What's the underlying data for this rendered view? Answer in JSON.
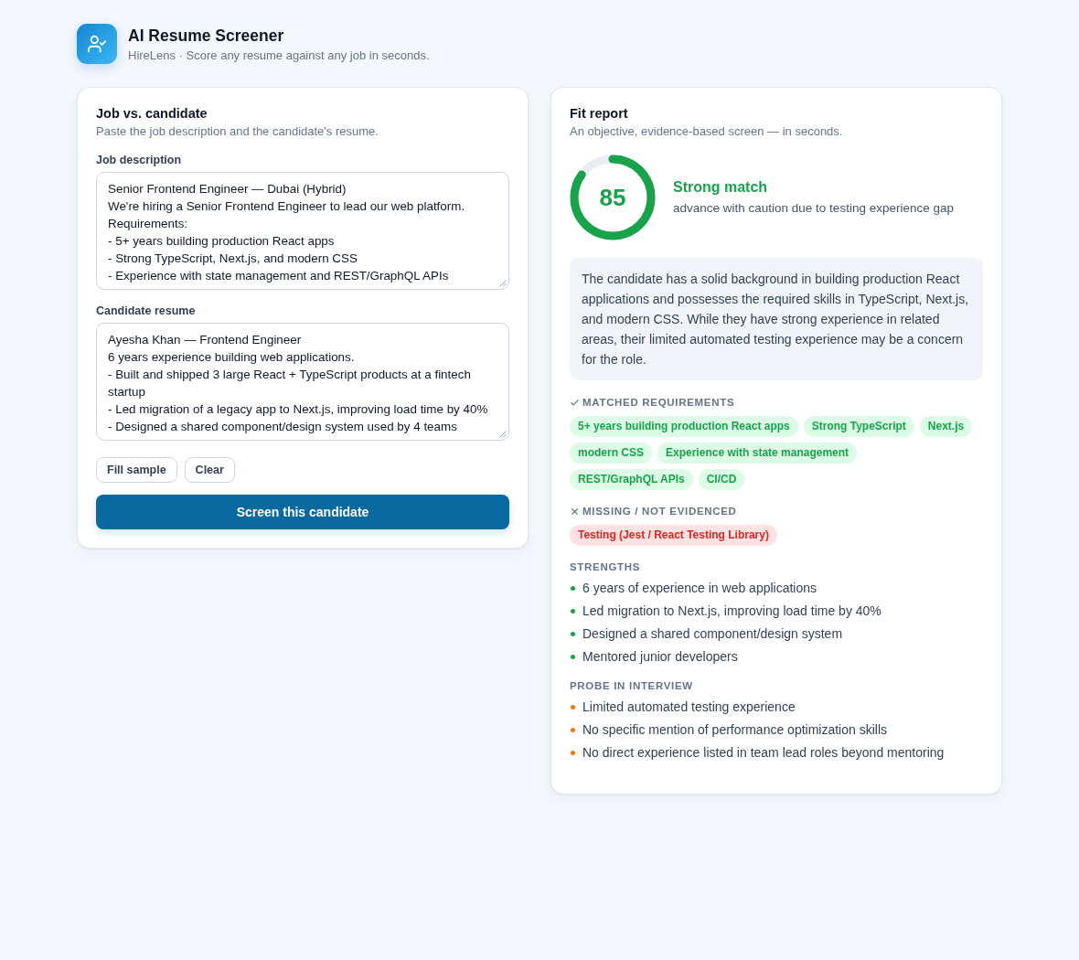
{
  "header": {
    "title": "AI Resume Screener",
    "subtitle": "HireLens · Score any resume against any job in seconds."
  },
  "input_panel": {
    "title": "Job vs. candidate",
    "subtitle": "Paste the job description and the candidate's resume.",
    "fields": [
      {
        "label": "Job description",
        "value": "Senior Frontend Engineer — Dubai (Hybrid)\nWe're hiring a Senior Frontend Engineer to lead our web platform.\nRequirements:\n- 5+ years building production React apps\n- Strong TypeScript, Next.js, and modern CSS\n- Experience with state management and REST/GraphQL APIs"
      },
      {
        "label": "Candidate resume",
        "value": "Ayesha Khan — Frontend Engineer\n6 years experience building web applications.\n- Built and shipped 3 large React + TypeScript products at a fintech startup\n- Led migration of a legacy app to Next.js, improving load time by 40%\n- Designed a shared component/design system used by 4 teams"
      }
    ],
    "secondary_buttons": [
      "Fill sample",
      "Clear"
    ],
    "primary_button": "Screen this candidate"
  },
  "report": {
    "title": "Fit report",
    "subtitle": "An objective, evidence-based screen — in seconds.",
    "score": {
      "value": "85",
      "level": 0.85
    },
    "verdict": "Strong match",
    "recommendation": "advance with caution due to testing experience gap",
    "summary": "The candidate has a solid background in building production React applications and possesses the required skills in TypeScript, Next.js, and modern CSS. While they have strong experience in related areas, their limited automated testing experience may be a concern for the role.",
    "sections": [
      {
        "kind": "matched",
        "heading": "MATCHED REQUIREMENTS",
        "items": [
          "5+ years building production React apps",
          "Strong TypeScript",
          "Next.js",
          "modern CSS",
          "Experience with state management",
          "REST/GraphQL APIs",
          "CI/CD"
        ]
      },
      {
        "kind": "missing",
        "heading": "MISSING / NOT EVIDENCED",
        "items": [
          "Testing (Jest / React Testing Library)"
        ]
      },
      {
        "kind": "strengths",
        "heading": "STRENGTHS",
        "items": [
          "6 years of experience in web applications",
          "Led migration to Next.js, improving load time by 40%",
          "Designed a shared component/design system",
          "Mentored junior developers"
        ]
      },
      {
        "kind": "probes",
        "heading": "PROBE IN INTERVIEW",
        "items": [
          "Limited automated testing experience",
          "No specific mention of performance optimization skills",
          "No direct experience listed in team lead roles beyond mentoring"
        ]
      }
    ]
  }
}
